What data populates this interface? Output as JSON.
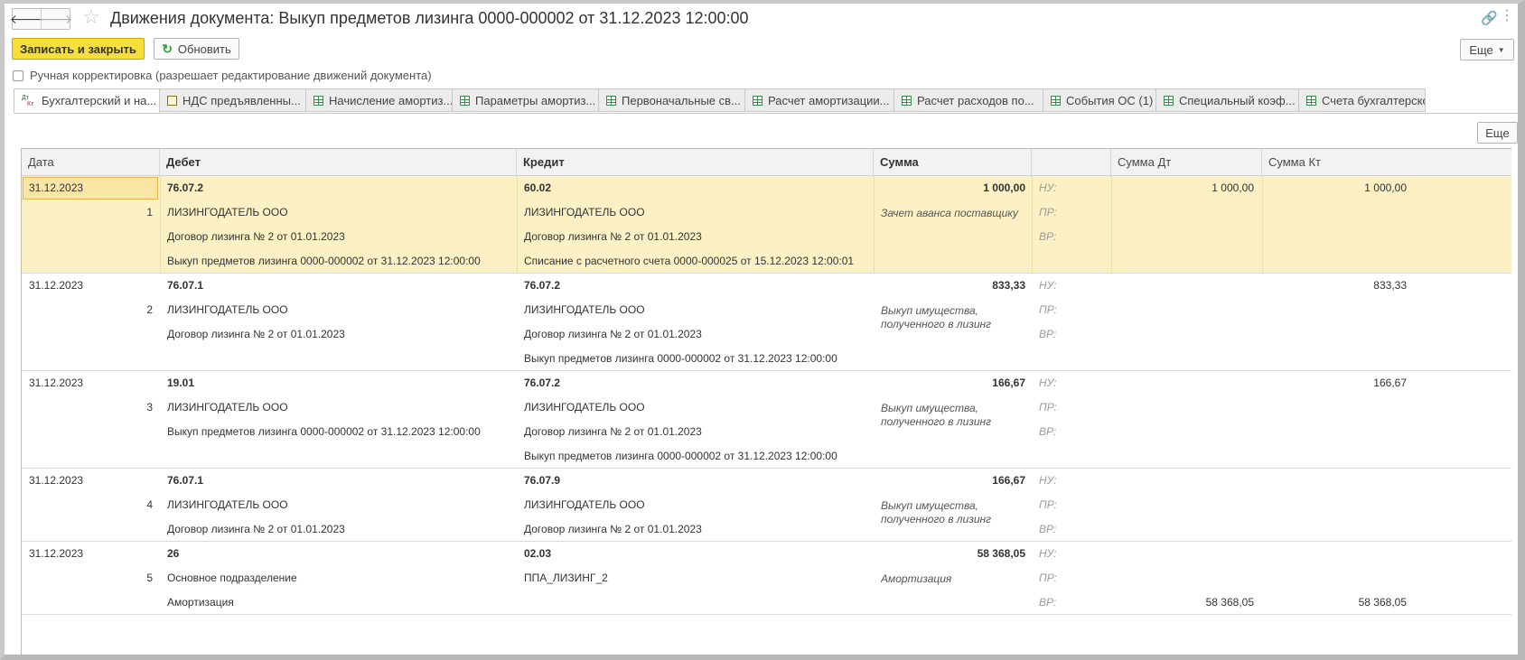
{
  "window": {
    "title": "Движения документа: Выкуп предметов лизинга 0000-000002 от 31.12.2023 12:00:00",
    "back_glyph": "🡐",
    "forward_glyph": "🡒",
    "star_glyph": "☆",
    "link_glyph": "🔗",
    "menu_glyph": "⋮"
  },
  "toolbar": {
    "save_label": "Записать и закрыть",
    "refresh_label": "Обновить",
    "refresh_glyph": "↻",
    "more_label": "Еще",
    "caret_glyph": "▼"
  },
  "manual_checkbox": {
    "label": "Ручная корректировка (разрешает редактирование движений документа)"
  },
  "tabs": [
    {
      "label": "Бухгалтерский и на...",
      "icon": "dt-kt-icon",
      "active": true
    },
    {
      "label": "НДС предъявленны...",
      "icon": "document-icon"
    },
    {
      "label": "Начисление амортиз...",
      "icon": "table-icon"
    },
    {
      "label": "Параметры амортиз...",
      "icon": "table-icon"
    },
    {
      "label": "Первоначальные св...",
      "icon": "table-icon"
    },
    {
      "label": "Расчет амортизации...",
      "icon": "table-icon"
    },
    {
      "label": "Расчет расходов по...",
      "icon": "table-icon"
    },
    {
      "label": "События ОС (1)",
      "icon": "table-icon"
    },
    {
      "label": "Специальный коэф...",
      "icon": "table-icon"
    },
    {
      "label": "Счета бухгалтерско",
      "icon": "table-icon"
    }
  ],
  "dt_label": "Дт",
  "kt_label": "Кт",
  "grid_more_label": "Еще",
  "table": {
    "headers": {
      "date": "Дата",
      "debit": "Дебет",
      "credit": "Кредит",
      "sum": "Сумма",
      "blank": "",
      "sum_dt": "Сумма Дт",
      "sum_kt": "Сумма Кт"
    },
    "type_labels": [
      "НУ:",
      "ПР:",
      "ВР:"
    ],
    "records": [
      {
        "date": "31.12.2023",
        "num": "1",
        "debit": [
          "76.07.2",
          "ЛИЗИНГОДАТЕЛЬ ООО",
          "Договор лизинга № 2 от 01.01.2023",
          "Выкуп предметов лизинга 0000-000002 от 31.12.2023 12:00:00"
        ],
        "credit": [
          "60.02",
          "ЛИЗИНГОДАТЕЛЬ ООО",
          "Договор лизинга № 2 от 01.01.2023",
          "Списание с расчетного счета 0000-000025 от 15.12.2023 12:00:01"
        ],
        "sum": "1 000,00",
        "content": "Зачет аванса поставщику",
        "sum_dt": [
          "1 000,00",
          "",
          ""
        ],
        "sum_kt": [
          "1 000,00",
          "",
          ""
        ]
      },
      {
        "date": "31.12.2023",
        "num": "2",
        "debit": [
          "76.07.1",
          "ЛИЗИНГОДАТЕЛЬ ООО",
          "Договор лизинга № 2 от 01.01.2023",
          ""
        ],
        "credit": [
          "76.07.2",
          "ЛИЗИНГОДАТЕЛЬ ООО",
          "Договор лизинга № 2 от 01.01.2023",
          "Выкуп предметов лизинга 0000-000002 от 31.12.2023 12:00:00"
        ],
        "sum": "833,33",
        "content": "Выкуп имущества, полученного в лизинг",
        "sum_dt": [
          "",
          "",
          ""
        ],
        "sum_kt": [
          "833,33",
          "",
          ""
        ]
      },
      {
        "date": "31.12.2023",
        "num": "3",
        "debit": [
          "19.01",
          "ЛИЗИНГОДАТЕЛЬ ООО",
          "Выкуп предметов лизинга 0000-000002 от 31.12.2023 12:00:00",
          ""
        ],
        "credit": [
          "76.07.2",
          "ЛИЗИНГОДАТЕЛЬ ООО",
          "Договор лизинга № 2 от 01.01.2023",
          "Выкуп предметов лизинга 0000-000002 от 31.12.2023 12:00:00"
        ],
        "sum": "166,67",
        "content": "Выкуп имущества, полученного в лизинг",
        "sum_dt": [
          "",
          "",
          ""
        ],
        "sum_kt": [
          "166,67",
          "",
          ""
        ]
      },
      {
        "date": "31.12.2023",
        "num": "4",
        "debit": [
          "76.07.1",
          "ЛИЗИНГОДАТЕЛЬ ООО",
          "Договор лизинга № 2 от 01.01.2023",
          ""
        ],
        "credit": [
          "76.07.9",
          "ЛИЗИНГОДАТЕЛЬ ООО",
          "Договор лизинга № 2 от 01.01.2023",
          ""
        ],
        "sum": "166,67",
        "content": "Выкуп имущества, полученного в лизинг",
        "sum_dt": [
          "",
          "",
          ""
        ],
        "sum_kt": [
          "",
          "",
          ""
        ]
      },
      {
        "date": "31.12.2023",
        "num": "5",
        "debit": [
          "26",
          "Основное подразделение",
          "Амортизация",
          ""
        ],
        "credit": [
          "02.03",
          "ППА_ЛИЗИНГ_2",
          "",
          ""
        ],
        "sum": "58 368,05",
        "content": "Амортизация",
        "sum_dt": [
          "",
          "",
          "58 368,05"
        ],
        "sum_kt": [
          "",
          "",
          "58 368,05"
        ]
      }
    ]
  }
}
